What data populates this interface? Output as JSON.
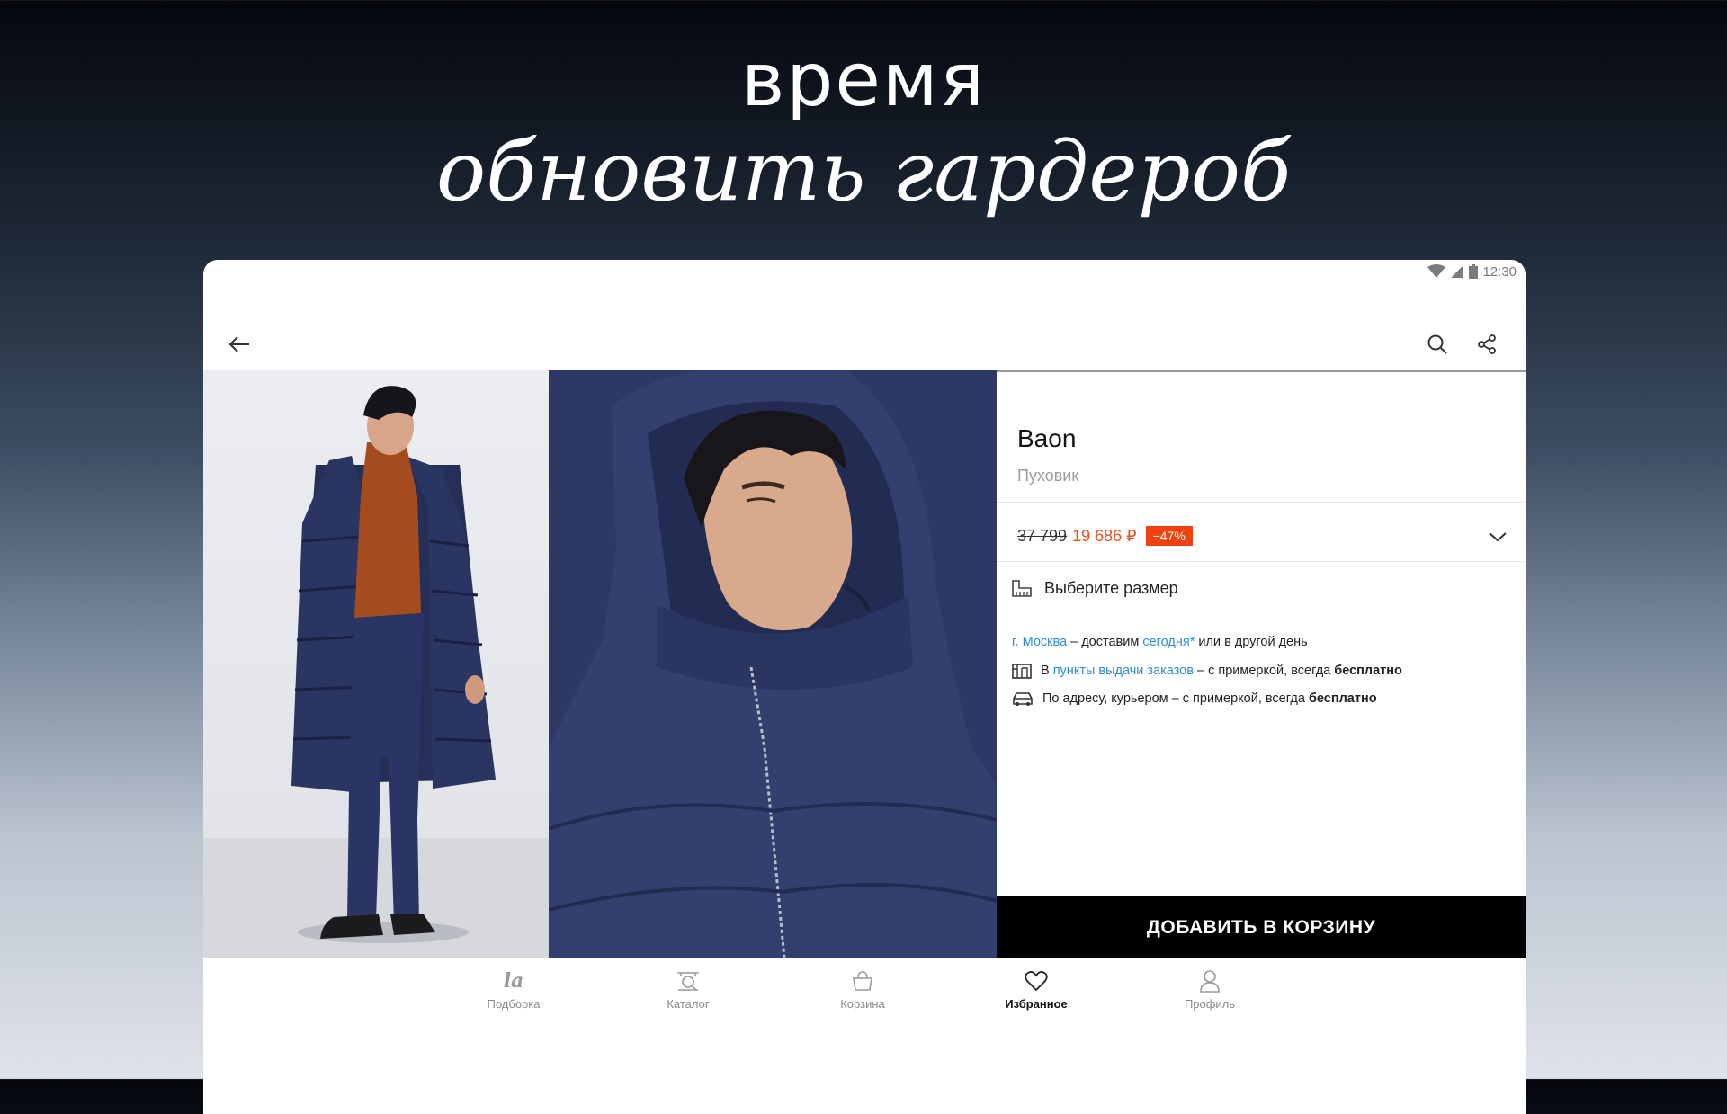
{
  "promo": {
    "line1": "время",
    "line2": "обновить гардероб"
  },
  "statusbar": {
    "time": "12:30"
  },
  "product": {
    "brand": "Baon",
    "category": "Пуховик",
    "price_old": "37 799",
    "price_new": "19 686 ₽",
    "discount": "−47%",
    "size_label": "Выберите размер"
  },
  "delivery": {
    "city": "г. Москва",
    "city_text": "– доставим",
    "today": "сегодня*",
    "other_day": "или в другой день",
    "pickup_prefix": "В",
    "pickup_link": "пункты выдачи заказов",
    "pickup_text": "– с примеркой, всегда",
    "pickup_free": "бесплатно",
    "courier_text": "По адресу, курьером  – с примеркой, всегда",
    "courier_free": "бесплатно"
  },
  "add_to_cart": "ДОБАВИТЬ В КОРЗИНУ",
  "tabs": [
    {
      "label": "Подборка",
      "icon": "la-logo-icon"
    },
    {
      "label": "Каталог",
      "icon": "catalog-icon"
    },
    {
      "label": "Корзина",
      "icon": "cart-icon"
    },
    {
      "label": "Избранное",
      "icon": "heart-icon",
      "active": true
    },
    {
      "label": "Профиль",
      "icon": "profile-icon"
    }
  ],
  "colors": {
    "accent_price": "#e8511d",
    "discount_bg": "#f0410e",
    "link": "#2f8dd6",
    "button": "#000000"
  }
}
